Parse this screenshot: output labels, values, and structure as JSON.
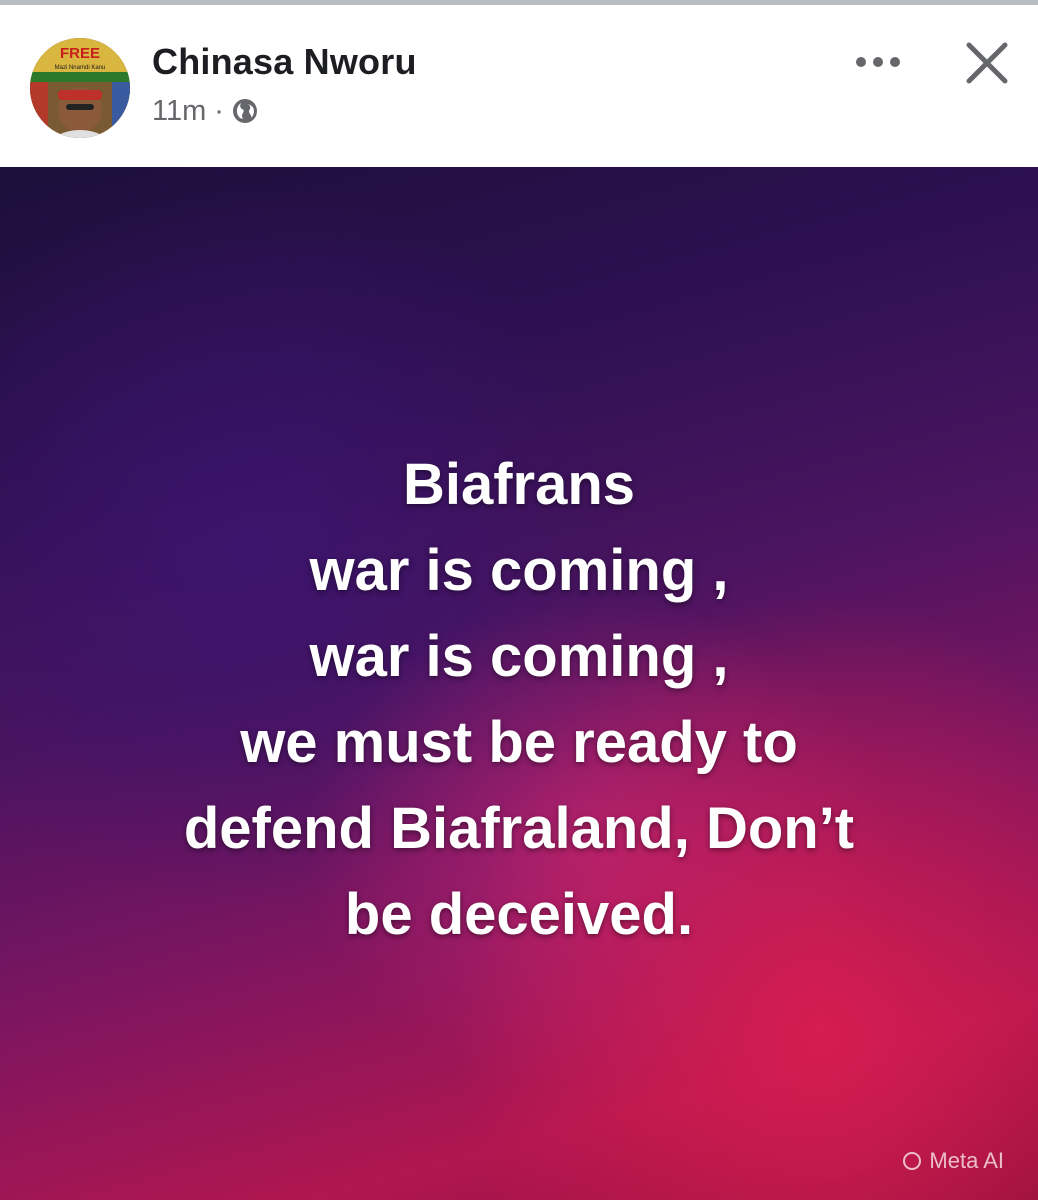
{
  "post": {
    "author_name": "Chinasa Nworu",
    "time_ago": "11m",
    "separator": "·",
    "privacy_icon": "globe-icon",
    "more_icon": "more-horizontal-icon",
    "close_icon": "close-icon",
    "body_lines": [
      "Biafrans",
      "war is coming ,",
      "war is coming ,",
      "we must be ready to",
      "defend Biafraland, Don’t",
      "be deceived."
    ],
    "watermark": "Meta AI"
  },
  "avatar": {
    "badge_text": "FREE",
    "badge_subtext": "Mazi Nnamdi Kanu"
  },
  "colors": {
    "name_text": "#1c1e21",
    "meta_text": "#65676b",
    "background_dark": "#2c1050",
    "background_magenta": "#b01650"
  }
}
